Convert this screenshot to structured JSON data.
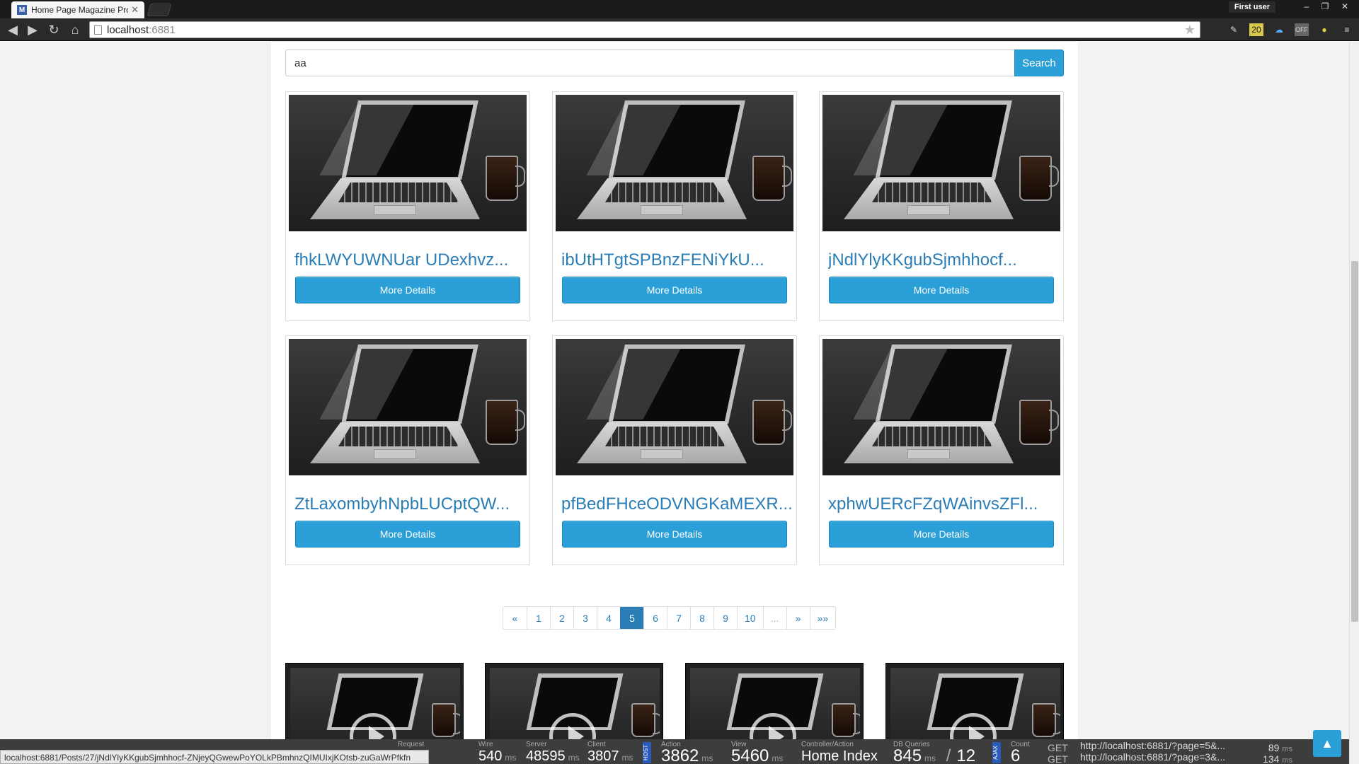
{
  "browser": {
    "tab_title": "Home Page Magazine Pro",
    "favicon_letter": "M",
    "user_label": "First user",
    "url_host": "localhost",
    "url_port": ":6881"
  },
  "search": {
    "value": "aa",
    "button_label": "Search"
  },
  "cards": [
    {
      "title": "fhkLWYUWNUar UDexhvz...",
      "button_label": "More Details"
    },
    {
      "title": "ibUtHTgtSPBnzFENiYkU...",
      "button_label": "More Details"
    },
    {
      "title": "jNdlYlyKKgubSjmhhocf...",
      "button_label": "More Details"
    },
    {
      "title": "ZtLaxombyhNpbLUCptQW...",
      "button_label": "More Details"
    },
    {
      "title": "pfBedFHceODVNGKaMEXR...",
      "button_label": "More Details"
    },
    {
      "title": "xphwUERcFZqWAinvsZFl...",
      "button_label": "More Details"
    }
  ],
  "pagination": {
    "items": [
      "«",
      "1",
      "2",
      "3",
      "4",
      "5",
      "6",
      "7",
      "8",
      "9",
      "10",
      "...",
      "»",
      "»»"
    ],
    "active": "5"
  },
  "status_url": "localhost:6881/Posts/27/jNdlYlyKKgubSjmhhocf-ZNjeyQGwewPoYOLkPBmhnzQIMUIxjKOtsb-zuGaWrPfkfn",
  "glimpse": {
    "request_label": "Request",
    "wire_label": "Wire",
    "wire_value": "540",
    "wire_unit": "ms",
    "server_label": "Server",
    "server_value": "48595",
    "server_unit": "ms",
    "client_label": "Client",
    "client_value": "3807",
    "client_unit": "ms",
    "host_tag": "HOST",
    "action_label": "Action",
    "action_value": "3862",
    "action_unit": "ms",
    "view_label": "View",
    "view_value": "5460",
    "view_unit": "ms",
    "controller_label": "Controller/Action",
    "controller_value": "Home Index",
    "db_label": "DB Queries",
    "db_time": "845",
    "db_unit": "ms",
    "db_separator": "/",
    "db_count": "12",
    "ajax_tag": "AJAX",
    "count_label": "Count",
    "count_value": "6",
    "ajax_requests": [
      {
        "method": "GET",
        "url": "http://localhost:6881/?page=5&...",
        "time": "89",
        "unit": "ms"
      },
      {
        "method": "GET",
        "url": "http://localhost:6881/?page=3&...",
        "time": "134",
        "unit": "ms"
      }
    ]
  }
}
